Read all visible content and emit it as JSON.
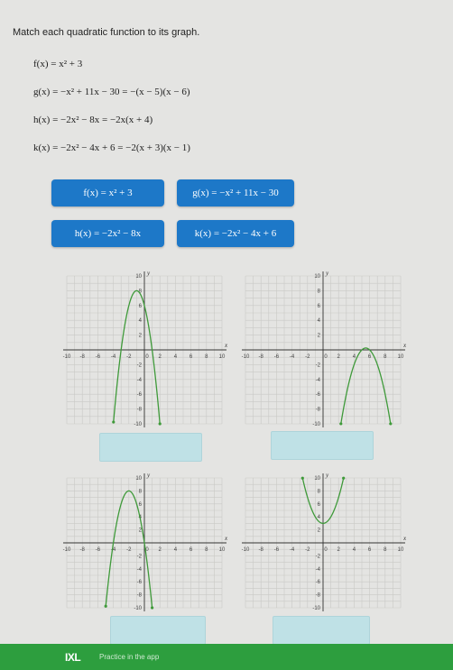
{
  "instructions": "Match each quadratic function to its graph.",
  "functions": [
    "f(x) = x² + 3",
    "g(x) = −x² + 11x − 30 = −(x − 5)(x − 6)",
    "h(x) = −2x² − 8x = −2x(x + 4)",
    "k(x) = −2x² − 4x + 6 = −2(x + 3)(x − 1)"
  ],
  "tiles": [
    "f(x) = x² + 3",
    "g(x) = −x² + 11x − 30",
    "h(x) = −2x² − 8x",
    "k(x) = −2x² − 4x + 6"
  ],
  "graphs": [
    {
      "a": -2,
      "b": -4,
      "c": 6
    },
    {
      "a": -1,
      "b": 11,
      "c": -30
    },
    {
      "a": -2,
      "b": -8,
      "c": 0
    },
    {
      "a": 1,
      "b": 0,
      "c": 3
    }
  ],
  "axis": {
    "xlim": [
      -10,
      10
    ],
    "ylim": [
      -10,
      10
    ],
    "x_ticks": [
      "-10",
      "-8",
      "-6",
      "-4",
      "-2",
      "0",
      "2",
      "4",
      "6",
      "8",
      "10"
    ],
    "y_ticks": [
      "10",
      "8",
      "6",
      "4",
      "2",
      "-2",
      "-4",
      "-6",
      "-8",
      "-10"
    ],
    "x_label": "x",
    "y_label": "y"
  },
  "colors": {
    "tile": "#1d78c8",
    "curve": "#3f9a3a",
    "dropzone": "#bfe1e6",
    "footer": "#2d9e3e"
  },
  "footer": {
    "logo": "IXL",
    "tagline": "Practice in the app"
  }
}
